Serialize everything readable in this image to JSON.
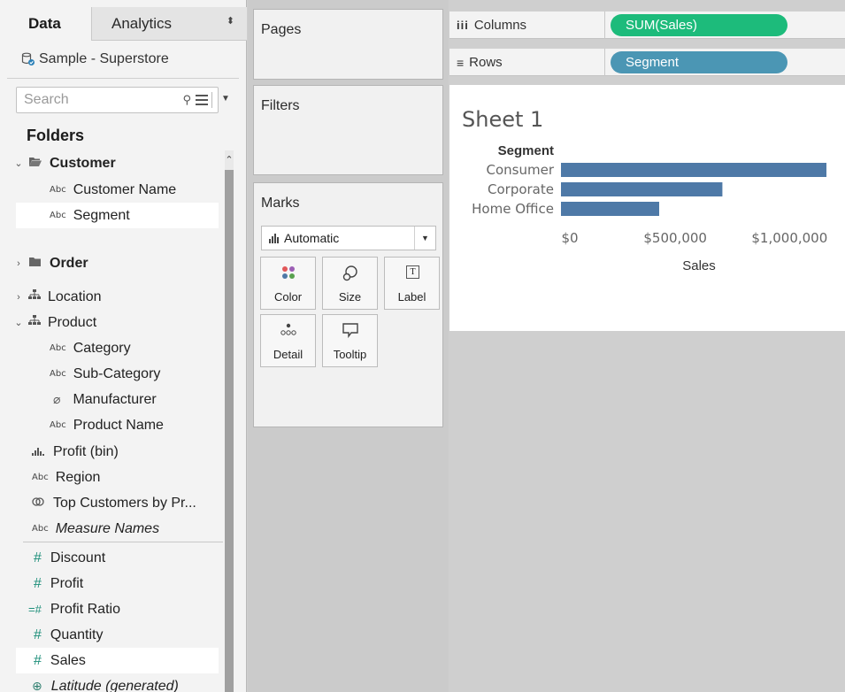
{
  "data_pane": {
    "tab_data": "Data",
    "tab_analytics": "Analytics",
    "datasource": "Sample - Superstore",
    "search_placeholder": "Search",
    "folders_title": "Folders",
    "items": [
      {
        "label": "Customer",
        "kind": "folder-open",
        "bold": true
      },
      {
        "label": "Customer Name",
        "kind": "abc"
      },
      {
        "label": "Segment",
        "kind": "abc",
        "selected": true
      },
      {
        "label": "Order",
        "kind": "folder",
        "bold": true
      },
      {
        "label": "Location",
        "kind": "hierarchy"
      },
      {
        "label": "Product",
        "kind": "hierarchy-open"
      },
      {
        "label": "Category",
        "kind": "abc"
      },
      {
        "label": "Sub-Category",
        "kind": "abc"
      },
      {
        "label": "Manufacturer",
        "kind": "clip"
      },
      {
        "label": "Product Name",
        "kind": "abc"
      },
      {
        "label": "Profit (bin)",
        "kind": "bin"
      },
      {
        "label": "Region",
        "kind": "abc"
      },
      {
        "label": "Top Customers by Pr...",
        "kind": "set"
      },
      {
        "label": "Measure Names",
        "kind": "abc",
        "italic": true
      },
      {
        "label": "Discount",
        "kind": "num"
      },
      {
        "label": "Profit",
        "kind": "num"
      },
      {
        "label": "Profit Ratio",
        "kind": "calc"
      },
      {
        "label": "Quantity",
        "kind": "num"
      },
      {
        "label": "Sales",
        "kind": "num",
        "selected": true
      },
      {
        "label": "Latitude (generated)",
        "kind": "geo",
        "italic": true
      }
    ]
  },
  "cards": {
    "pages": "Pages",
    "filters": "Filters",
    "marks": "Marks",
    "mark_type": "Automatic",
    "buttons": {
      "color": "Color",
      "size": "Size",
      "label": "Label",
      "detail": "Detail",
      "tooltip": "Tooltip"
    }
  },
  "shelves": {
    "columns_label": "Columns",
    "columns_pill": "SUM(Sales)",
    "rows_label": "Rows",
    "rows_pill": "Segment"
  },
  "sheet_title": "Sheet 1",
  "chart_data": {
    "type": "bar",
    "orientation": "horizontal",
    "row_header": "Segment",
    "categories": [
      "Consumer",
      "Corporate",
      "Home Office"
    ],
    "values": [
      1161401,
      706146,
      429653
    ],
    "xlabel": "Sales",
    "xlim": [
      0,
      1200000
    ],
    "ticks": [
      0,
      500000,
      1000000
    ],
    "tick_labels": [
      "$0",
      "$500,000",
      "$1,000,000"
    ],
    "color": "#4e79a7"
  },
  "colors": {
    "pill_measure": "#1dbb7b",
    "pill_dimension": "#4b96b4",
    "bar": "#4e79a7"
  }
}
